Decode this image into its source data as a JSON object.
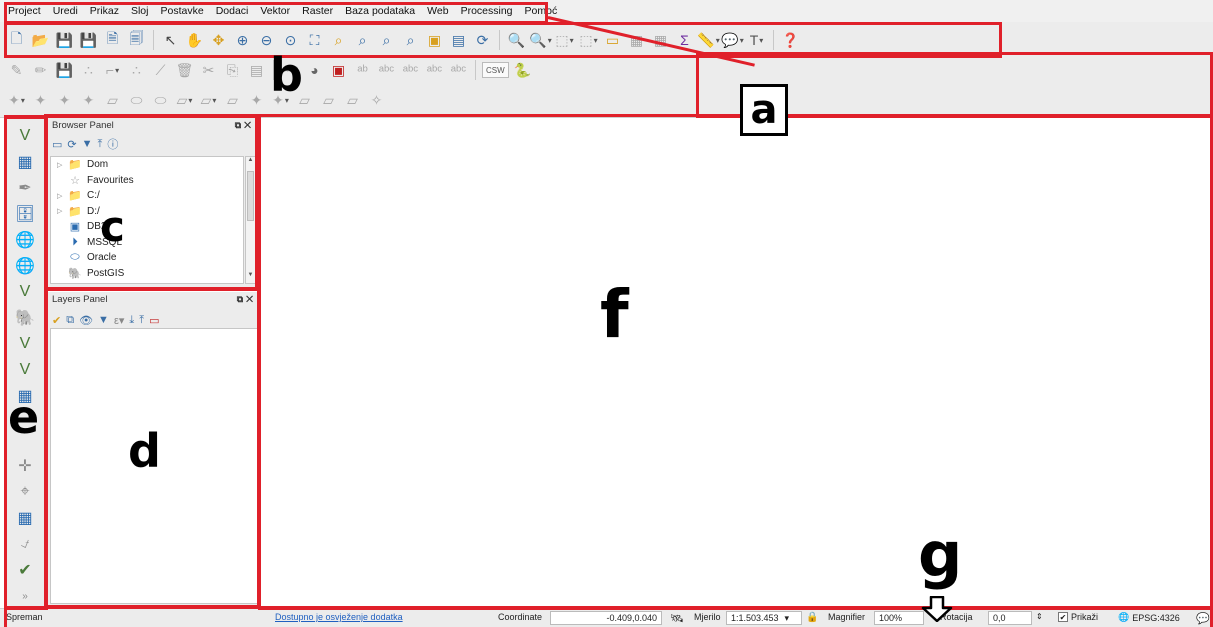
{
  "menu": [
    "Project",
    "Uredi",
    "Prikaz",
    "Sloj",
    "Postavke",
    "Dodaci",
    "Vektor",
    "Raster",
    "Baza podataka",
    "Web",
    "Processing",
    "Pomoć"
  ],
  "toolbar_csw_label": "CSW",
  "browser_panel": {
    "title": "Browser Panel",
    "items": [
      {
        "label": "Dom",
        "icon": "folder-icon",
        "expandable": true
      },
      {
        "label": "Favourites",
        "icon": "star-icon",
        "expandable": false
      },
      {
        "label": "C:/",
        "icon": "folder-icon",
        "expandable": true
      },
      {
        "label": "D:/",
        "icon": "folder-icon",
        "expandable": true
      },
      {
        "label": "DB2",
        "icon": "db2-icon",
        "expandable": false
      },
      {
        "label": "MSSQL",
        "icon": "mssql-icon",
        "expandable": false
      },
      {
        "label": "Oracle",
        "icon": "oracle-icon",
        "expandable": false
      },
      {
        "label": "PostGIS",
        "icon": "postgis-icon",
        "expandable": false
      }
    ]
  },
  "layers_panel": {
    "title": "Layers Panel"
  },
  "statusbar": {
    "ready": "Spreman",
    "plugin_link": "Dostupno je osvježenje dodatka",
    "coordinate_label": "Coordinate",
    "coordinate_value": "-0.409,0.040",
    "scale_label": "Mjerilo",
    "scale_value": "1:1.503.453",
    "magnifier_label": "Magnifier",
    "magnifier_value": "100%",
    "rotation_label": "Rotacija",
    "rotation_value": "0,0",
    "render_label": "Prikaži",
    "crs": "EPSG:4326"
  },
  "annotations": {
    "a": "a",
    "b": "b",
    "c": "c",
    "d": "d",
    "e": "e",
    "f": "f",
    "g": "g"
  },
  "colors": {
    "annotation_red": "#e0202a",
    "ui_bg": "#ececec"
  }
}
